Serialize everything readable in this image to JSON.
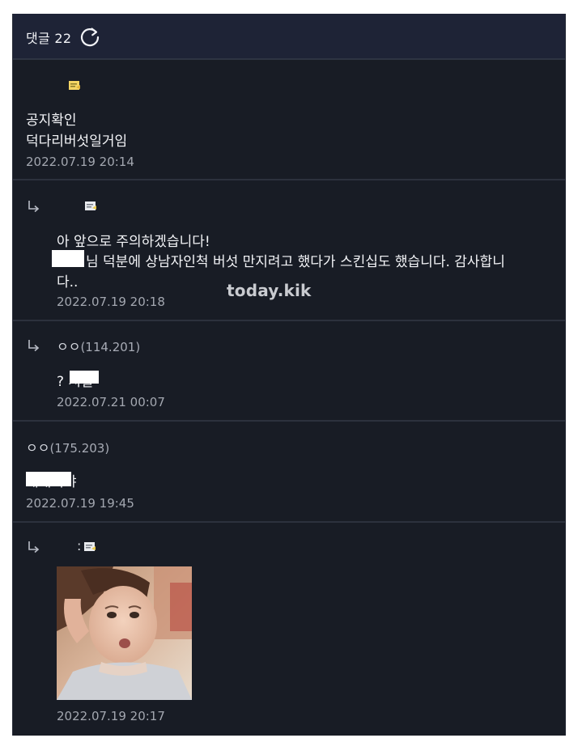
{
  "header": {
    "label": "댓글 22",
    "refresh_icon": "refresh-icon"
  },
  "watermark": "today.kik",
  "comments": [
    {
      "is_reply": false,
      "nickname": "",
      "ip": "",
      "has_badge": true,
      "lines": [
        "공지확인",
        "덕다리버섯일거임"
      ],
      "date": "2022.07.19 20:14"
    },
    {
      "is_reply": true,
      "nickname": "",
      "ip": "",
      "has_badge": true,
      "lines": [
        "아 앞으로 주의하겠습니다!",
        "님 덕분에 상남자인척 버섯 만지려고 했다가 스킨십도 했습니다. 감사합니",
        "다.."
      ],
      "date": "2022.07.19 20:18"
    },
    {
      "is_reply": true,
      "nickname": "ㅇㅇ",
      "ip": "(114.201)",
      "has_badge": false,
      "lines": [
        "? 시발"
      ],
      "date": "2022.07.21 00:07"
    },
    {
      "is_reply": false,
      "nickname": "ㅇㅇ",
      "ip": "(175.203)",
      "has_badge": false,
      "lines": [
        "개새끼야"
      ],
      "date": "2022.07.19 19:45"
    },
    {
      "is_reply": true,
      "nickname": ":",
      "ip": "",
      "has_badge": true,
      "lines": [],
      "has_image": true,
      "date": "2022.07.19 20:17"
    }
  ],
  "colors": {
    "panel_bg": "#181c25",
    "header_bg": "#1e2336",
    "divider": "#2c313d",
    "text": "#f4f5f8",
    "date": "#a3a7b0",
    "badge": "#e8c84a"
  }
}
